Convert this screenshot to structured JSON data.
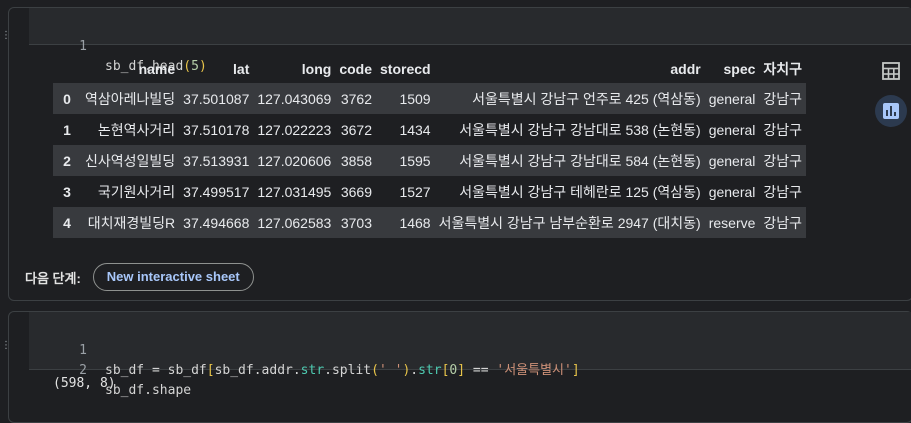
{
  "cell1": {
    "code_lines": [
      {
        "num": "1",
        "text": "sb_df.head(5)"
      }
    ],
    "table": {
      "columns": [
        "",
        "name",
        "lat",
        "long",
        "code",
        "storecd",
        "addr",
        "spec",
        "자치구"
      ],
      "rows": [
        [
          "0",
          "역삼아레나빌딩",
          "37.501087",
          "127.043069",
          "3762",
          "1509",
          "서울특별시 강남구 언주로 425 (역삼동)",
          "general",
          "강남구"
        ],
        [
          "1",
          "논현역사거리",
          "37.510178",
          "127.022223",
          "3672",
          "1434",
          "서울특별시 강남구 강남대로 538 (논현동)",
          "general",
          "강남구"
        ],
        [
          "2",
          "신사역성일빌딩",
          "37.513931",
          "127.020606",
          "3858",
          "1595",
          "서울특별시 강남구 강남대로 584 (논현동)",
          "general",
          "강남구"
        ],
        [
          "3",
          "국기원사거리",
          "37.499517",
          "127.031495",
          "3669",
          "1527",
          "서울특별시 강남구 테헤란로 125 (역삼동)",
          "general",
          "강남구"
        ],
        [
          "4",
          "대치재경빌딩R",
          "37.494668",
          "127.062583",
          "3703",
          "1468",
          "서울특별시 강남구 남부순환로 2947 (대치동)",
          "reserve",
          "강남구"
        ]
      ]
    },
    "next_steps_label": "다음 단계:",
    "new_sheet_button": "New interactive sheet",
    "side_icons": [
      "table-icon",
      "chart-icon"
    ]
  },
  "cell2": {
    "code_lines": [
      {
        "num": "1",
        "text": "sb_df = sb_df[sb_df.addr.str.split(' ').str[0] == '서울특별시']"
      },
      {
        "num": "2",
        "text": "sb_df.shape"
      }
    ],
    "output": "(598, 8)"
  },
  "colors": {
    "background": "#1e1f22",
    "code_bg": "#282a2d",
    "odd_row": "#383a3e",
    "accent": "#a8c7fa"
  }
}
